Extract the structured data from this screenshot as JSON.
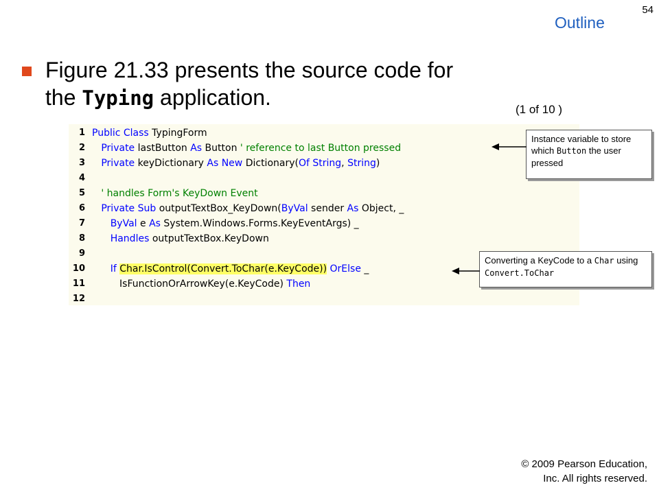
{
  "slide": {
    "page_number": "54",
    "outline_title": "Outline",
    "pagination": "(1 of 10 )",
    "bullet": {
      "text_before": "Figure 21.33 presents the source code for the ",
      "code_word": "Typing",
      "text_after": " application."
    }
  },
  "code": {
    "lines": [
      {
        "num": "1",
        "parts": [
          {
            "t": "Public Class",
            "c": "kw"
          },
          {
            "t": " TypingForm"
          }
        ]
      },
      {
        "num": "2",
        "parts": [
          {
            "t": "   "
          },
          {
            "t": "Private",
            "c": "kw"
          },
          {
            "t": " lastButton "
          },
          {
            "t": "As",
            "c": "kw"
          },
          {
            "t": " Button "
          },
          {
            "t": "' reference to last Button pressed",
            "c": "cm"
          }
        ]
      },
      {
        "num": "3",
        "parts": [
          {
            "t": "   "
          },
          {
            "t": "Private",
            "c": "kw"
          },
          {
            "t": " keyDictionary "
          },
          {
            "t": "As New",
            "c": "kw"
          },
          {
            "t": " Dictionary("
          },
          {
            "t": "Of String",
            "c": "kw"
          },
          {
            "t": ", "
          },
          {
            "t": "String",
            "c": "kw"
          },
          {
            "t": ")"
          }
        ]
      },
      {
        "num": "4",
        "parts": []
      },
      {
        "num": "5",
        "parts": [
          {
            "t": "   "
          },
          {
            "t": "' handles Form's KeyDown Event",
            "c": "cm"
          }
        ]
      },
      {
        "num": "6",
        "parts": [
          {
            "t": "   "
          },
          {
            "t": "Private Sub",
            "c": "kw"
          },
          {
            "t": " outputTextBox_KeyDown("
          },
          {
            "t": "ByVal",
            "c": "kw"
          },
          {
            "t": " sender "
          },
          {
            "t": "As",
            "c": "kw"
          },
          {
            "t": " Object, _"
          }
        ]
      },
      {
        "num": "7",
        "parts": [
          {
            "t": "      "
          },
          {
            "t": "ByVal",
            "c": "kw"
          },
          {
            "t": " e "
          },
          {
            "t": "As",
            "c": "kw"
          },
          {
            "t": " System.Windows.Forms.KeyEventArgs) _"
          }
        ]
      },
      {
        "num": "8",
        "parts": [
          {
            "t": "      "
          },
          {
            "t": "Handles",
            "c": "kw"
          },
          {
            "t": " outputTextBox.KeyDown"
          }
        ]
      },
      {
        "num": "9",
        "parts": []
      },
      {
        "num": "10",
        "parts": [
          {
            "t": "      "
          },
          {
            "t": "If",
            "c": "kw"
          },
          {
            "t": " "
          },
          {
            "t": "Char.IsControl(Convert.ToChar(e.KeyCode))",
            "c": "hl"
          },
          {
            "t": " "
          },
          {
            "t": "OrElse",
            "c": "kw"
          },
          {
            "t": " _"
          }
        ]
      },
      {
        "num": "11",
        "parts": [
          {
            "t": "         IsFunctionOrArrowKey(e.KeyCode) "
          },
          {
            "t": "Then",
            "c": "kw"
          }
        ]
      },
      {
        "num": "12",
        "parts": []
      }
    ]
  },
  "callouts": {
    "instance_variable": {
      "text1": "Instance variable to store which ",
      "code1": "Button",
      "text2": " the user pressed"
    },
    "converting": {
      "text1": "Converting a KeyCode to a ",
      "code1": "Char",
      "text2": " using ",
      "code2": "Convert.ToChar"
    }
  },
  "footer": {
    "copyright_line1": "© 2009 Pearson Education,",
    "copyright_line2": "Inc.  All rights reserved."
  },
  "colors": {
    "outline_title": "#1f5fbf",
    "bullet_marker": "#e0481c",
    "keyword": "#0000ff",
    "comment": "#008000",
    "highlight": "#ffff66",
    "code_background": "#fcfbed"
  }
}
